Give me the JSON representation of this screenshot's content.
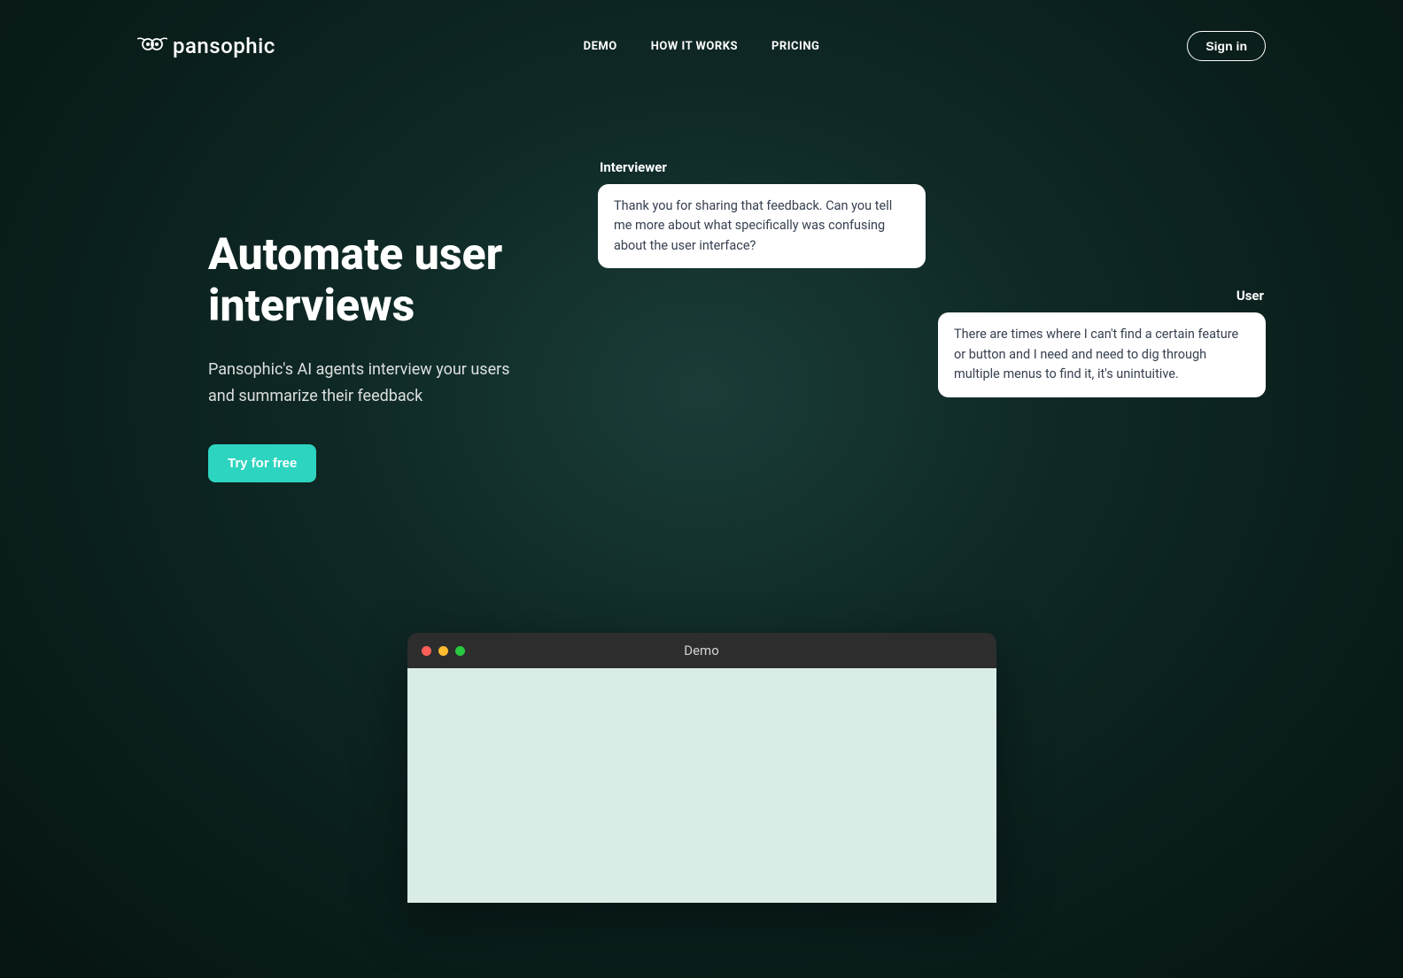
{
  "brand": {
    "name": "pansophic"
  },
  "nav": {
    "items": [
      {
        "label": "DEMO"
      },
      {
        "label": "HOW IT WORKS"
      },
      {
        "label": "PRICING"
      }
    ]
  },
  "auth": {
    "signin_label": "Sign in"
  },
  "hero": {
    "title": "Automate user interviews",
    "subtitle": "Pansophic's AI agents interview your users and summarize their feedback",
    "cta_label": "Try for free"
  },
  "chat": {
    "interviewer_label": "Interviewer",
    "interviewer_message": "Thank you for sharing that feedback. Can you tell me more about what specifically was confusing about the user interface?",
    "user_label": "User",
    "user_message": "There are times where I can't find a certain feature or button and I need and need to dig through multiple menus to find it, it's unintuitive."
  },
  "demo": {
    "title": "Demo"
  }
}
